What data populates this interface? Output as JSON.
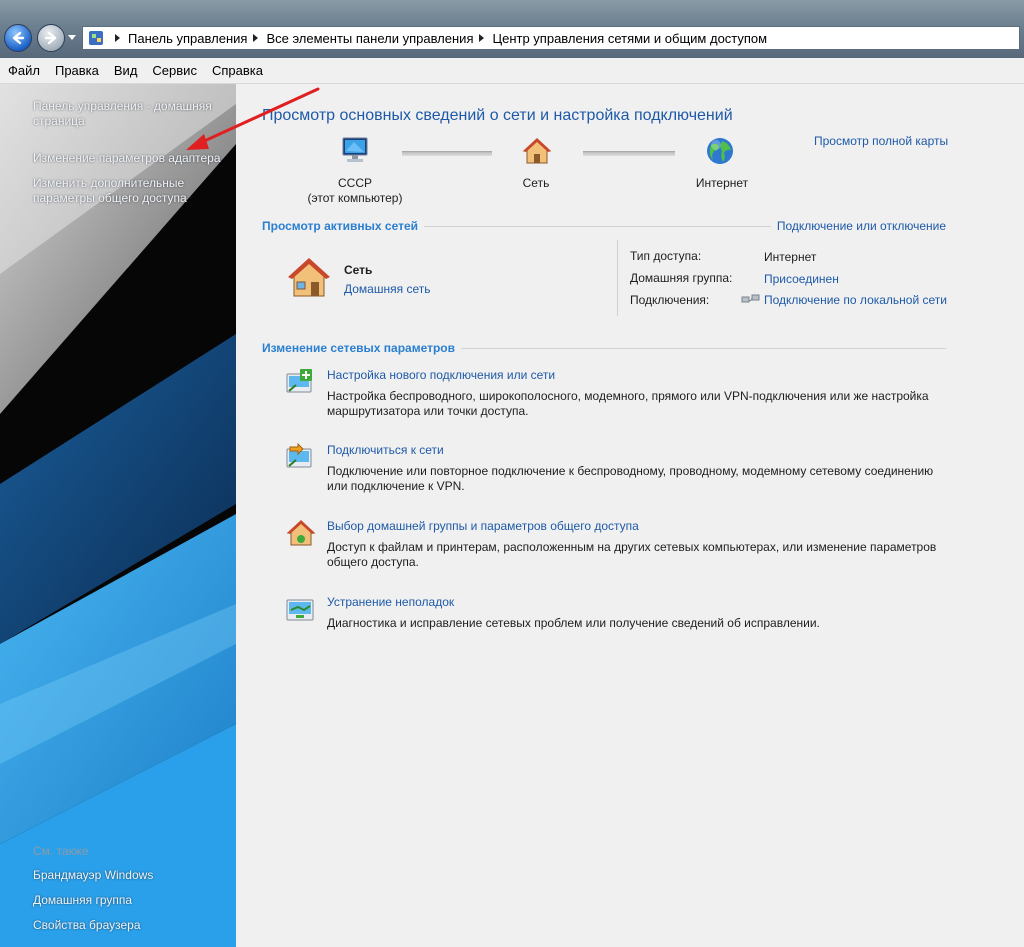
{
  "address_bar": {
    "crumbs": [
      "Панель управления",
      "Все элементы панели управления",
      "Центр управления сетями и общим доступом"
    ]
  },
  "menu": [
    "Файл",
    "Правка",
    "Вид",
    "Сервис",
    "Справка"
  ],
  "sidebar": {
    "home_link": "Панель управления - домашняя страница",
    "adapter_link": "Изменение параметров адаптера",
    "sharing_link": "Изменить дополнительные параметры общего доступа",
    "see_also": "См. также",
    "see_also_links": [
      "Брандмауэр Windows",
      "Домашняя группа",
      "Свойства браузера"
    ]
  },
  "main": {
    "title": "Просмотр основных сведений о сети и настройка подключений",
    "full_map_link": "Просмотр полной карты",
    "map": {
      "computer_name": "СССР",
      "computer_sub": "(этот компьютер)",
      "network": "Сеть",
      "internet": "Интернет"
    },
    "active": {
      "heading": "Просмотр активных сетей",
      "connect_link": "Подключение или отключение",
      "net_name": "Сеть",
      "net_type": "Домашняя сеть",
      "access_label": "Тип доступа:",
      "access_value": "Интернет",
      "homegroup_label": "Домашняя группа:",
      "homegroup_value": "Присоединен",
      "connections_label": "Подключения:",
      "connections_value": "Подключение по локальной сети"
    },
    "change": {
      "heading": "Изменение сетевых параметров",
      "tasks": [
        {
          "title": "Настройка нового подключения или сети",
          "desc": "Настройка беспроводного, широкополосного, модемного, прямого или VPN-подключения или же настройка маршрутизатора или точки доступа."
        },
        {
          "title": "Подключиться к сети",
          "desc": "Подключение или повторное подключение к беспроводному, проводному, модемному сетевому соединению или подключение к VPN."
        },
        {
          "title": "Выбор домашней группы и параметров общего доступа",
          "desc": "Доступ к файлам и принтерам, расположенным на других сетевых компьютерах, или изменение параметров общего доступа."
        },
        {
          "title": "Устранение неполадок",
          "desc": "Диагностика и исправление сетевых проблем или получение сведений об исправлении."
        }
      ]
    }
  },
  "colors": {
    "link": "#1e5aa8",
    "section_heading": "#2a7fd0",
    "annotation_arrow": "#e02020"
  }
}
